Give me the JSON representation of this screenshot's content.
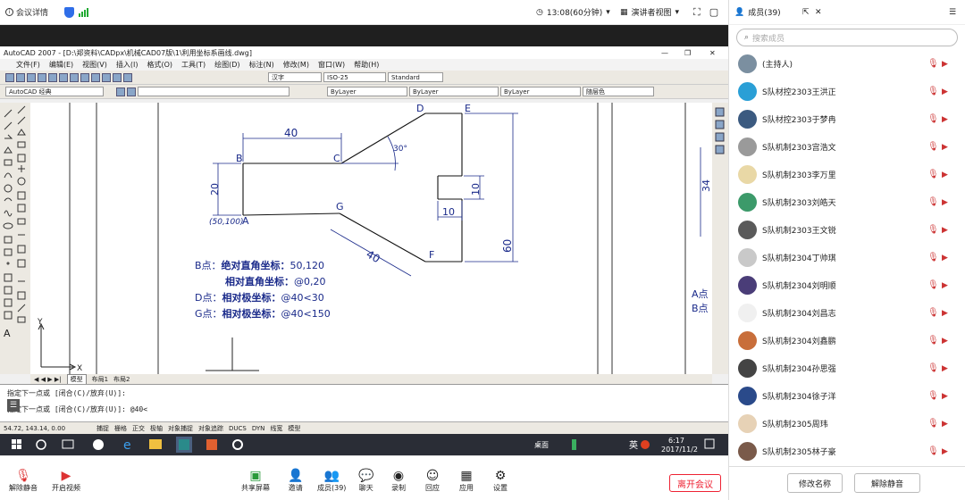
{
  "topbar": {
    "meeting_details": "会议详情",
    "timer": "13:08(60分钟)",
    "view_mode": "演讲者视图"
  },
  "panel": {
    "header": "成员(39)",
    "search_placeholder": "搜索成员",
    "members": [
      {
        "name": "(主持人)",
        "color": "#7b8fa0"
      },
      {
        "name": "S队材控2303王洪正",
        "color": "#2a9fd6"
      },
      {
        "name": "S队材控2303于梦冉",
        "color": "#3b5a80"
      },
      {
        "name": "S队机制2303宫浩文",
        "color": "#9a9a9a"
      },
      {
        "name": "S队机制2303李万里",
        "color": "#e9d8a6"
      },
      {
        "name": "S队机制2303刘皓天",
        "color": "#3c9a6a"
      },
      {
        "name": "S队机制2303王文锐",
        "color": "#5a5a5a"
      },
      {
        "name": "S队机制2304丁帅琪",
        "color": "#c9c9c9"
      },
      {
        "name": "S队机制2304刘明顺",
        "color": "#4a3d78"
      },
      {
        "name": "S队机制2304刘昌志",
        "color": "#f0f0f0"
      },
      {
        "name": "S队机制2304刘鑫鹏",
        "color": "#c86e3a"
      },
      {
        "name": "S队机制2304孙思强",
        "color": "#444444"
      },
      {
        "name": "S队机制2304徐子洋",
        "color": "#2a4a8a"
      },
      {
        "name": "S队机制2305周玮",
        "color": "#e7d2b6"
      },
      {
        "name": "S队机制2305林子豪",
        "color": "#7a5a4a"
      }
    ],
    "rename_btn": "修改名称",
    "unmute_btn": "解除静音"
  },
  "acad": {
    "title": "AutoCAD 2007 - [D:\\郑资料\\CADpx\\机械CAD07版\\1\\利用坐标系画线.dwg]",
    "menus": [
      "文件(F)",
      "编辑(E)",
      "视图(V)",
      "插入(I)",
      "格式(O)",
      "工具(T)",
      "绘图(D)",
      "标注(N)",
      "修改(M)",
      "窗口(W)",
      "帮助(H)"
    ],
    "workspace": "AutoCAD 经典",
    "text_style": "汉字",
    "dim_style": "ISO-25",
    "table_style": "Standard",
    "layer": "ByLayer",
    "linetype": "ByLayer",
    "lineweight": "ByLayer",
    "color_ctrl": "随层色",
    "tabs": [
      "模型",
      "布局1",
      "布局2"
    ],
    "cmd_line1": "指定下一点或 [闭合(C)/放弃(U)]:",
    "cmd_line2": "指定下一点或 [闭合(C)/放弃(U)]: @40<",
    "coords": "54.72, 143.14, 0.00",
    "status_items": [
      "捕捉",
      "栅格",
      "正交",
      "极轴",
      "对象捕捉",
      "对象追踪",
      "DUCS",
      "DYN",
      "线宽",
      "模型"
    ]
  },
  "drawing": {
    "labels": {
      "B": "B",
      "C": "C",
      "D": "D",
      "E": "E",
      "G": "G",
      "F": "F",
      "A": "A",
      "a_coord": "(50,100)"
    },
    "dims": {
      "bc": "40",
      "ab": "20",
      "de": "60",
      "tab_v": "10",
      "tab_h": "10",
      "gf": "40",
      "angle": "30°",
      "right": "34"
    },
    "notes": [
      {
        "key": "B点：",
        "bold": "绝对直角坐标：",
        "val": "50,120"
      },
      {
        "key": "",
        "bold": "相对直角坐标：",
        "val": "@0,20"
      },
      {
        "key": "D点：",
        "bold": "相对极坐标：",
        "val": "@40<30"
      },
      {
        "key": "G点：",
        "bold": "相对极坐标：",
        "val": "@40<150"
      }
    ],
    "right_notes": [
      "A点",
      "B点"
    ],
    "ucs_x": "X",
    "ucs_y": "Y"
  },
  "taskbar": {
    "desktop": "桌面",
    "lang": "英",
    "time": "6:17",
    "date": "2017/11/2"
  },
  "bottombar": {
    "mute": "解除静音",
    "video": "开启视频",
    "share": "共享屏幕",
    "invite": "邀请",
    "members": "成员(39)",
    "chat": "聊天",
    "record": "录制",
    "interact": "回应",
    "apps": "应用",
    "settings": "设置",
    "leave": "离开会议"
  }
}
